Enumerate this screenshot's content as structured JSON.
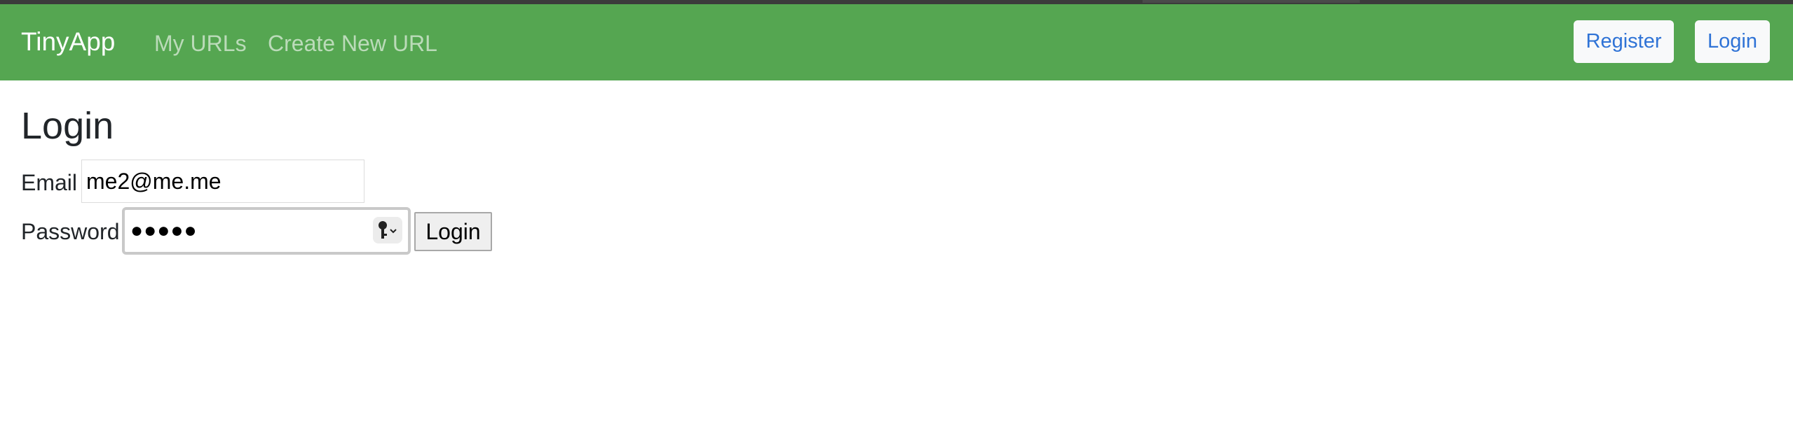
{
  "navbar": {
    "brand": "TinyApp",
    "links": [
      {
        "label": "My URLs"
      },
      {
        "label": "Create New URL"
      }
    ],
    "buttons": [
      {
        "label": "Register"
      },
      {
        "label": "Login"
      }
    ]
  },
  "main": {
    "title": "Login",
    "email": {
      "label": "Email",
      "value": "me2@me.me"
    },
    "password": {
      "label": "Password",
      "value": "●●●●●"
    },
    "submit_label": "Login"
  },
  "icons": {
    "password_manager": "key-icon"
  },
  "colors": {
    "navbar_bg": "#55a651",
    "nav_button_text": "#2f73d6",
    "nav_button_bg": "#f8f9fa"
  }
}
